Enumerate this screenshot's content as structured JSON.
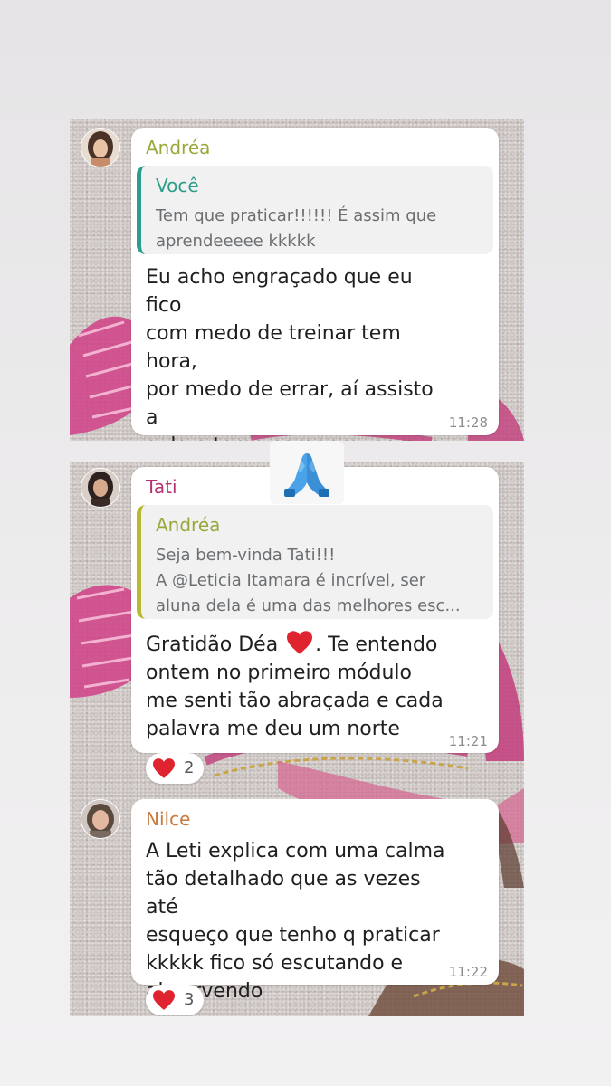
{
  "messages": [
    {
      "sender": "Andréa",
      "sender_color": "#9aa83a",
      "quote": {
        "author": "Você",
        "author_color": "#2c9d8a",
        "text": "Tem que praticar!!!!!! É assim que\naprendeeeee kkkkk"
      },
      "text": "Eu acho engraçado que eu fico\ncom medo de treinar tem hora,\npor medo de errar, aí assisto a\naula e tomo coragem, porque\nsempre fala algo que motiva e\nme sinto mais confortável",
      "time": "11:28"
    },
    {
      "sender": "Tati",
      "sender_color": "#b3336e",
      "quote": {
        "author": "Andréa",
        "author_color": "#9aa83a",
        "text": "Seja bem-vinda Tati!!!\nA @Leticia Itamara é incrível, ser\naluna dela é uma das melhores esc..."
      },
      "text_before_emoji": "Gratidão Déa",
      "text_emoji": "red-heart-icon",
      "text_after_emoji": ". Te entendo\nontem no primeiro módulo\nme senti tão abraçada e cada\npalavra me deu um norte",
      "time": "11:21",
      "reaction": {
        "icon": "red-heart-icon",
        "count": "2"
      }
    },
    {
      "sender": "Nilce",
      "sender_color": "#c97a3c",
      "text": "A Leti explica com uma calma\ntão detalhado que as vezes até\nesqueço que tenho q praticar\nkkkkk fico só escutando e\nabsorvendo",
      "time": "11:22",
      "reaction": {
        "icon": "red-heart-icon",
        "count": "3"
      }
    }
  ],
  "sticker": {
    "icon": "folded-hands-emoji-icon"
  }
}
